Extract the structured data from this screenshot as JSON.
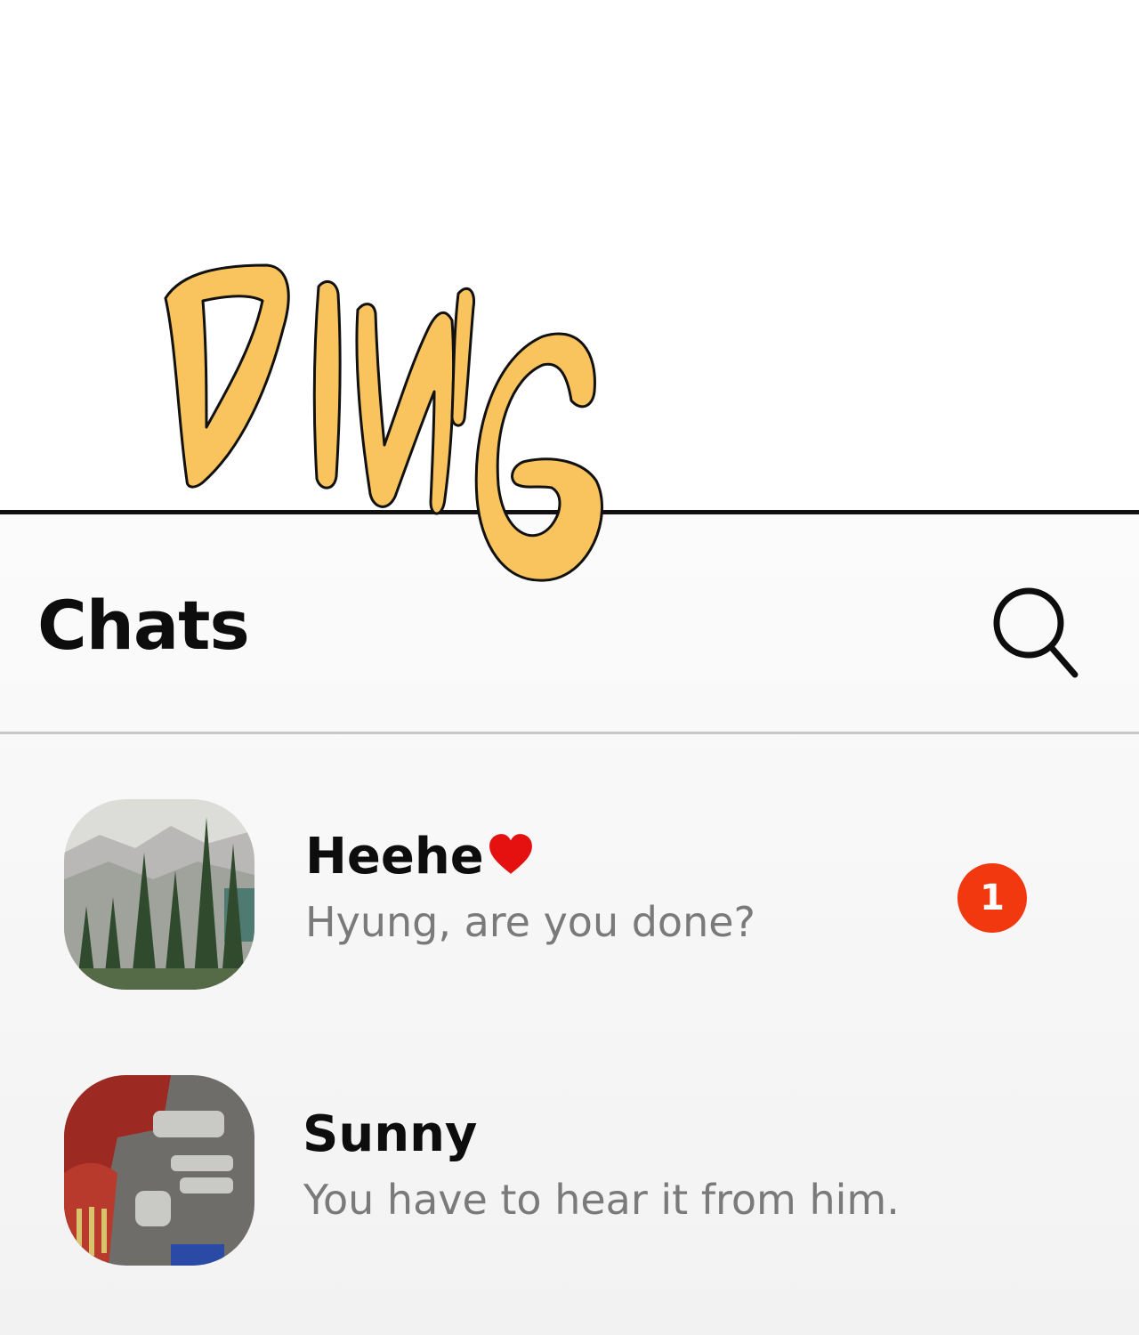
{
  "sound_effect": "DING",
  "header": {
    "title": "Chats"
  },
  "chats": [
    {
      "name": "Heehe",
      "preview": "Hyung, are you done?",
      "unread_count": "1",
      "avatar_icon": "forest-photo",
      "name_icon": "heart-icon"
    },
    {
      "name": "Sunny",
      "preview": "You have to hear it from him.",
      "avatar_icon": "engine-photo"
    }
  ],
  "colors": {
    "sfx_fill": "#f9c45e",
    "badge": "#f2380f",
    "heart": "#e51010",
    "title": "#0d0d0d",
    "preview_text": "#7a7a7a"
  }
}
